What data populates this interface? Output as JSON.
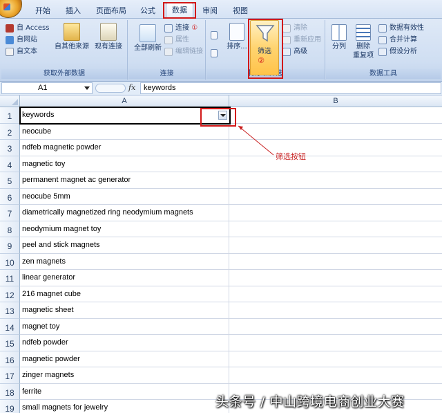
{
  "tabs": [
    {
      "label": "开始"
    },
    {
      "label": "插入"
    },
    {
      "label": "页面布局"
    },
    {
      "label": "公式"
    },
    {
      "label": "数据"
    },
    {
      "label": "审阅"
    },
    {
      "label": "视图"
    }
  ],
  "ribbon": {
    "external_data": {
      "access": "自 Access",
      "web": "自网站",
      "text": "自文本",
      "other_sources": "自其他来源",
      "existing_connections": "现有连接",
      "label": "获取外部数据"
    },
    "connections": {
      "refresh_all": "全部刷新",
      "connections": "连接",
      "connections_marker": "①",
      "properties": "属性",
      "edit_links": "编辑链接",
      "label": "连接"
    },
    "sort_filter": {
      "sort": "排序...",
      "filter": "筛选",
      "filter_marker": "②",
      "clear": "清除",
      "reapply": "重新应用",
      "advanced": "高级",
      "label": "排序和筛选"
    },
    "data_tools": {
      "text_to_columns": "分列",
      "remove_duplicates_line1": "删除",
      "remove_duplicates_line2": "重复项",
      "data_validation": "数据有效性",
      "consolidate": "合并计算",
      "what_if": "假设分析",
      "label": "数据工具"
    }
  },
  "formula_bar": {
    "name_box": "A1",
    "fx": "fx",
    "value": "keywords"
  },
  "sheet": {
    "columns": [
      "A",
      "B"
    ],
    "rows": [
      {
        "num": "1",
        "a": "keywords"
      },
      {
        "num": "2",
        "a": "neocube"
      },
      {
        "num": "3",
        "a": "ndfeb magnetic powder"
      },
      {
        "num": "4",
        "a": "magnetic toy"
      },
      {
        "num": "5",
        "a": "permanent magnet ac generator"
      },
      {
        "num": "6",
        "a": "neocube 5mm"
      },
      {
        "num": "7",
        "a": "diametrically magnetized ring neodymium magnets"
      },
      {
        "num": "8",
        "a": "neodymium magnet toy"
      },
      {
        "num": "9",
        "a": "peel and stick magnets"
      },
      {
        "num": "10",
        "a": "zen magnets"
      },
      {
        "num": "11",
        "a": "linear generator"
      },
      {
        "num": "12",
        "a": "216 magnet cube"
      },
      {
        "num": "13",
        "a": "magnetic sheet"
      },
      {
        "num": "14",
        "a": "magnet toy"
      },
      {
        "num": "15",
        "a": "ndfeb powder"
      },
      {
        "num": "16",
        "a": "magnetic powder"
      },
      {
        "num": "17",
        "a": "zinger magnets"
      },
      {
        "num": "18",
        "a": "ferrite"
      },
      {
        "num": "19",
        "a": "small magnets for jewelry"
      }
    ]
  },
  "annotation": {
    "text": "筛选按钮"
  },
  "watermark": {
    "text": "头条号 / 中山跨境电商创业大赛"
  },
  "colors": {
    "highlight": "#d21818",
    "ribbon": "#cfdef2",
    "filter_active": "#ffd470"
  }
}
